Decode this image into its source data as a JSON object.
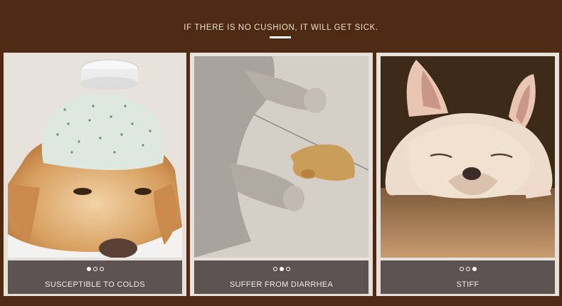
{
  "header": {
    "title": "IF THERE IS NO CUSHION, IT WILL GET SICK."
  },
  "cards": [
    {
      "caption": "SUSCEPTIBLE TO COLDS",
      "image_icon": "golden-retriever-ice-bag",
      "active_dot": 1,
      "dot_count": 3
    },
    {
      "caption": "SUFFER FROM DIARRHEA",
      "image_icon": "puppy-paws-on-floor",
      "active_dot": 2,
      "dot_count": 3
    },
    {
      "caption": "STIFF",
      "image_icon": "french-bulldog-lying",
      "active_dot": 3,
      "dot_count": 3
    }
  ],
  "colors": {
    "background": "#4f2a12",
    "card_frame": "#e7e1dc",
    "caption_bar": "#5c5350",
    "text_light": "#ffffff"
  }
}
